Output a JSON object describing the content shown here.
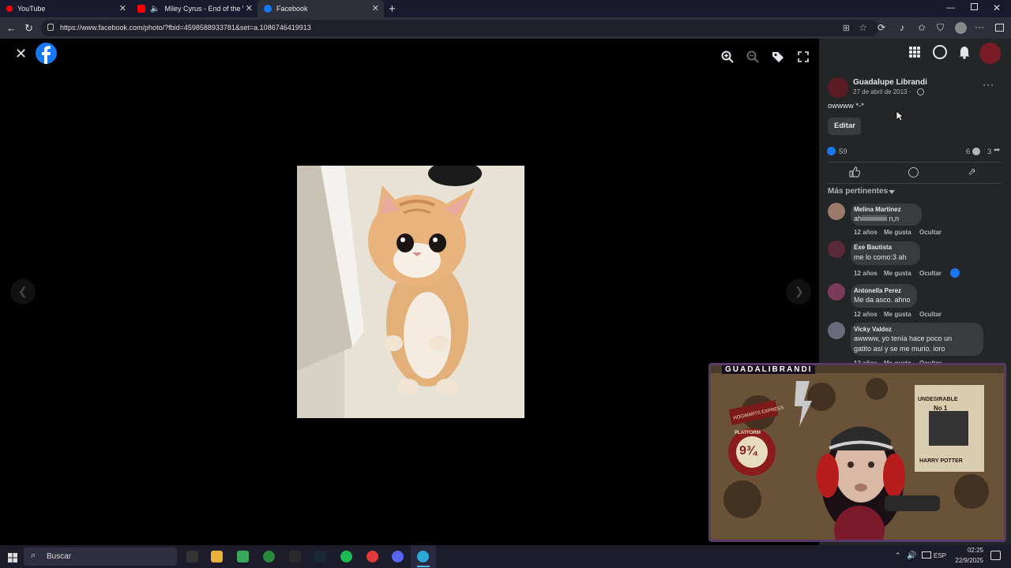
{
  "browser": {
    "tabs": [
      {
        "label": "YouTube"
      },
      {
        "label": "Miley Cyrus - End of the Wo"
      },
      {
        "label": "Facebook"
      }
    ],
    "new_tab": "+",
    "url": "https://www.facebook.com/photo/?fbid=4598588933781&set=a.1086746419913"
  },
  "post": {
    "author": "Guadalupe Librandi",
    "date": "27 de abril de 2013 ·",
    "caption": "owwww *-*",
    "edit_label": "Editar",
    "like_count": "59",
    "comment_count": "6",
    "share_count": "3",
    "sort_label": "Más pertinentes"
  },
  "comments": [
    {
      "name": "Melina Martinez",
      "text": "ahiiiiiiiiiiiiiiii n,n",
      "time": "12 años",
      "like": "Me gusta",
      "hide": "Ocultar"
    },
    {
      "name": "Exe Bautista",
      "text": "me lo como:3 ah",
      "time": "12 años",
      "like": "Me gusta",
      "hide": "Ocultar"
    },
    {
      "name": "Antonella Perez",
      "text": "Me da asco. ahno",
      "time": "12 años",
      "like": "Me gusta",
      "hide": "Ocultar"
    },
    {
      "name": "Vicky Valdez",
      "text1": "awwww, yo tenía hace poco un",
      "text2": "gatito así y se me murio. ioro",
      "time": "12 años",
      "like": "Me gusta",
      "hide": "Ocultar"
    }
  ],
  "overlay": {
    "streamer": "GUADALIBRANDI",
    "poster_title": "UNDESIRABLE",
    "poster_number": "No 1",
    "poster_name": "HARRY POTTER",
    "sign_platform": "PLATFORM",
    "sign_number": "9¾",
    "sign_express": "HOGWARTS EXPRESS"
  },
  "taskbar": {
    "search_placeholder": "Buscar",
    "lang": "ESP",
    "time": "02:25",
    "date": "22/9/2025"
  },
  "colors": {
    "facebook_blue": "#1877f2",
    "panel_bg": "#242526"
  }
}
